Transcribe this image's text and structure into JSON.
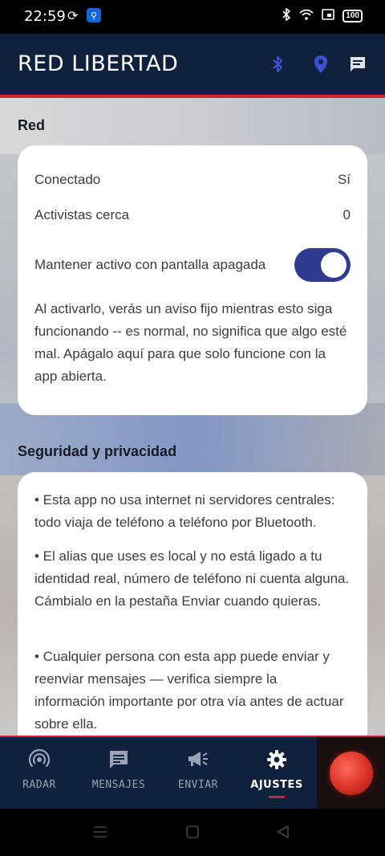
{
  "status_bar": {
    "time": "22:59",
    "battery": "100"
  },
  "app_bar": {
    "title": "RED LIBERTAD"
  },
  "sections": {
    "red": {
      "title": "Red",
      "connected_label": "Conectado",
      "connected_value": "Sí",
      "nearby_label": "Activistas cerca",
      "nearby_value": "0",
      "keep_active_label": "Mantener activo con pantalla apagada",
      "keep_active_on": true,
      "description": "Al activarlo, verás un aviso fijo mientras esto siga funcionando -- es normal, no significa que algo esté mal. Apágalo aquí para que solo funcione con la app abierta."
    },
    "security": {
      "title": "Seguridad y privacidad",
      "items": [
        "• Esta app no usa internet ni servidores centrales: todo viaja de teléfono a teléfono por Bluetooth.",
        "• El alias que uses es local y no está ligado a tu identidad real, número de teléfono ni cuenta alguna. Cámbialo en la pestaña Enviar cuando quieras.",
        "• Cualquier persona con esta app puede enviar y reenviar mensajes — verifica siempre la información importante por otra vía antes de actuar sobre ella."
      ]
    }
  },
  "bottom_nav": {
    "items": [
      {
        "label": "RADAR",
        "icon": "radar-icon"
      },
      {
        "label": "MENSAJES",
        "icon": "message-icon"
      },
      {
        "label": "ENVIAR",
        "icon": "megaphone-icon"
      },
      {
        "label": "AJUSTES",
        "icon": "gear-icon",
        "active": true
      }
    ]
  },
  "colors": {
    "app_bar": "#10213d",
    "accent_red": "#d71f3a",
    "toggle_on": "#2e3b8f",
    "status_icon_blue": "#3b4fd1"
  }
}
